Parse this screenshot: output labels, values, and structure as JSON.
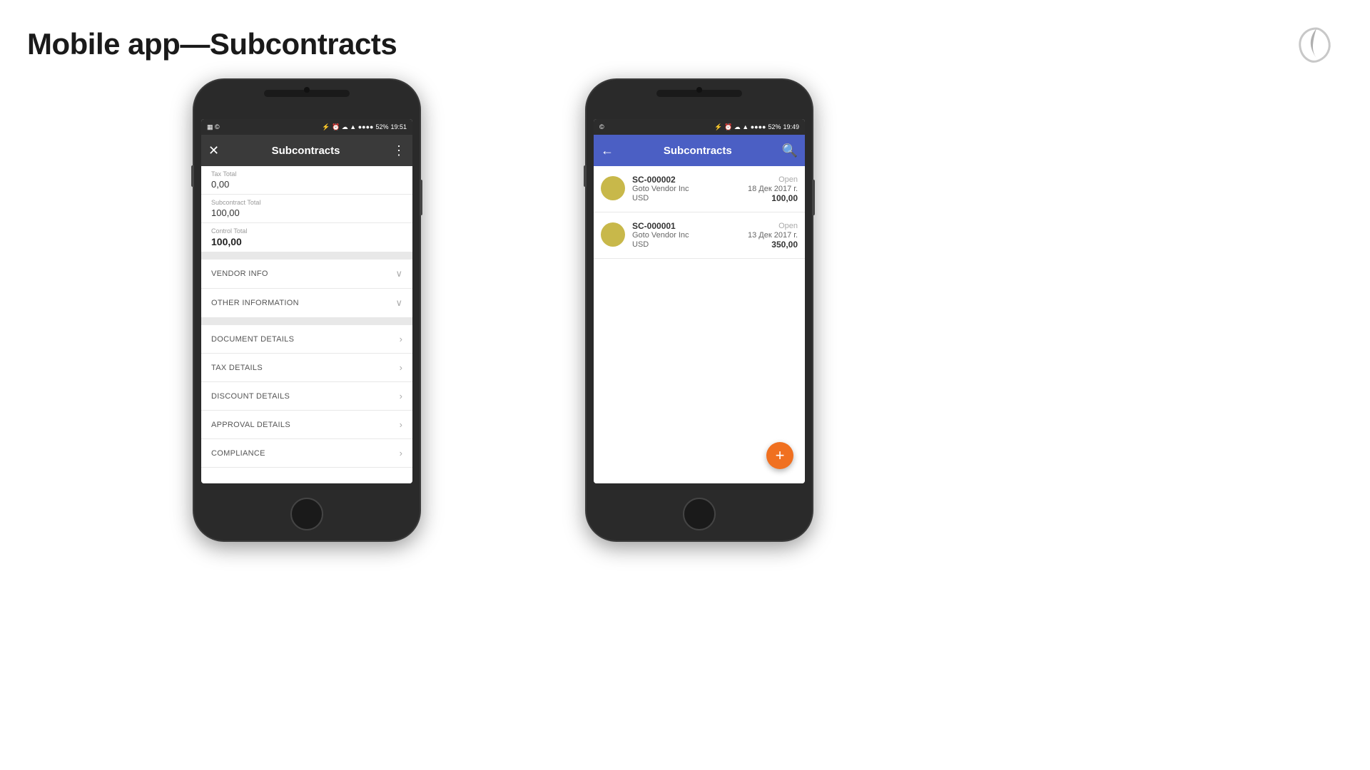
{
  "page": {
    "title": "Mobile app—Subcontracts",
    "background": "#ffffff"
  },
  "logo": {
    "aria": "company-logo"
  },
  "phone_left": {
    "status_bar": {
      "time": "19:51",
      "battery": "52%",
      "signal": "●●●●"
    },
    "header": {
      "title": "Subcontracts",
      "close_icon": "✕",
      "menu_icon": "⋮",
      "style": "dark"
    },
    "fields": [
      {
        "label": "Tax Total",
        "value": "0,00",
        "bold": false
      },
      {
        "label": "Subcontract Total",
        "value": "100,00",
        "bold": false
      },
      {
        "label": "Control Total",
        "value": "100,00",
        "bold": true
      }
    ],
    "sections": [
      {
        "label": "VENDOR INFO",
        "icon": "chevron-down"
      },
      {
        "label": "OTHER INFORMATION",
        "icon": "chevron-down"
      },
      {
        "label": "DOCUMENT DETAILS",
        "icon": "chevron-right"
      },
      {
        "label": "TAX DETAILS",
        "icon": "chevron-right"
      },
      {
        "label": "DISCOUNT DETAILS",
        "icon": "chevron-right"
      },
      {
        "label": "APPROVAL DETAILS",
        "icon": "chevron-right"
      },
      {
        "label": "COMPLIANCE",
        "icon": "chevron-right"
      }
    ]
  },
  "phone_right": {
    "status_bar": {
      "time": "19:49",
      "battery": "52%",
      "signal": "●●●●"
    },
    "header": {
      "title": "Subcontracts",
      "back_icon": "←",
      "search_icon": "🔍",
      "style": "blue"
    },
    "list": [
      {
        "sc_number": "SC-000002",
        "status": "Open",
        "vendor": "Goto Vendor Inc",
        "date": "18 Дек 2017 г.",
        "currency": "USD",
        "amount": "100,00",
        "avatar_color": "#c8b84a"
      },
      {
        "sc_number": "SC-000001",
        "status": "Open",
        "vendor": "Goto Vendor Inc",
        "date": "13 Дек 2017 г.",
        "currency": "USD",
        "amount": "350,00",
        "avatar_color": "#c8b84a"
      }
    ],
    "fab_label": "+"
  }
}
